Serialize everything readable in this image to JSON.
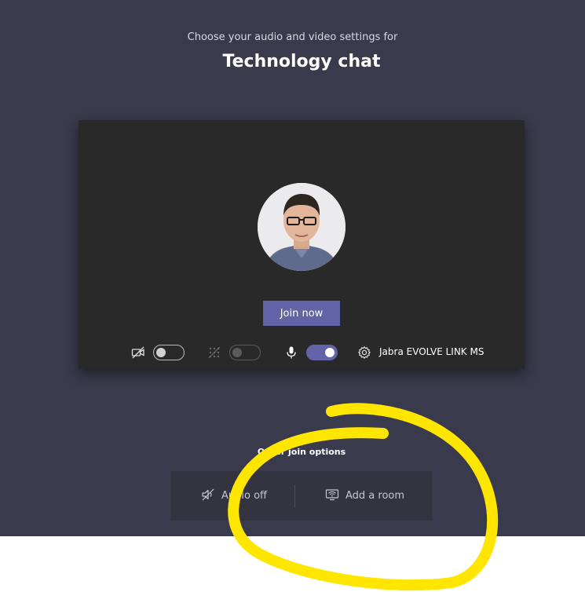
{
  "header": {
    "subtitle": "Choose your audio and video settings for",
    "meeting_title": "Technology chat"
  },
  "preview": {
    "join_button_label": "Join now",
    "controls": {
      "camera_toggle_on": false,
      "blur_toggle_on": false,
      "mic_toggle_on": true,
      "device_label": "Jabra EVOLVE LINK MS"
    }
  },
  "other_options": {
    "heading": "Other join options",
    "audio_off_label": "Audio off",
    "add_room_label": "Add a room"
  },
  "colors": {
    "background": "#393a4b",
    "preview": "#292929",
    "accent": "#6264a7",
    "annotation": "#ffe600"
  }
}
